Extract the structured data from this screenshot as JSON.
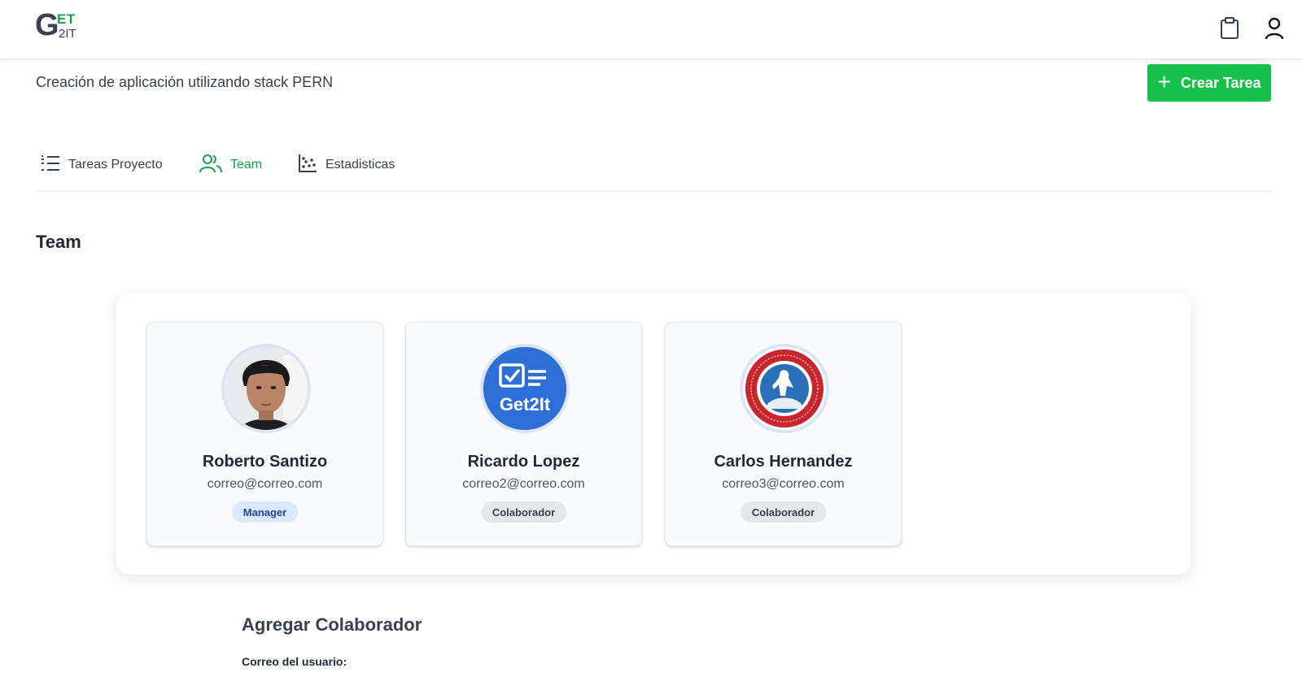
{
  "header": {
    "logo": {
      "g": "G",
      "et": "ET",
      "twoit": "2IT"
    },
    "icons": [
      "clipboard-icon",
      "user-icon"
    ]
  },
  "project": {
    "description": "Creación de aplicación utilizando stack PERN",
    "create_button_label": "Crear Tarea"
  },
  "tabs": [
    {
      "label": "Tareas Proyecto",
      "icon": "list-icon",
      "active": false
    },
    {
      "label": "Team",
      "icon": "users-icon",
      "active": true
    },
    {
      "label": "Estadisticas",
      "icon": "scatter-chart-icon",
      "active": false
    }
  ],
  "section_title": "Team",
  "team": [
    {
      "name": "Roberto Santizo",
      "email": "correo@correo.com",
      "role": "Manager",
      "avatar": "photo"
    },
    {
      "name": "Ricardo Lopez",
      "email": "correo2@correo.com",
      "role": "Colaborador",
      "avatar": "get2it-logo",
      "avatar_text": "Get2It"
    },
    {
      "name": "Carlos Hernandez",
      "email": "correo3@correo.com",
      "role": "Colaborador",
      "avatar": "university-seal"
    }
  ],
  "add_collaborator": {
    "title": "Agregar Colaborador",
    "email_label": "Correo del usuario:"
  },
  "colors": {
    "accent": "#16c04a",
    "active_tab": "#16a34a",
    "manager_badge": "#dbeafe"
  }
}
